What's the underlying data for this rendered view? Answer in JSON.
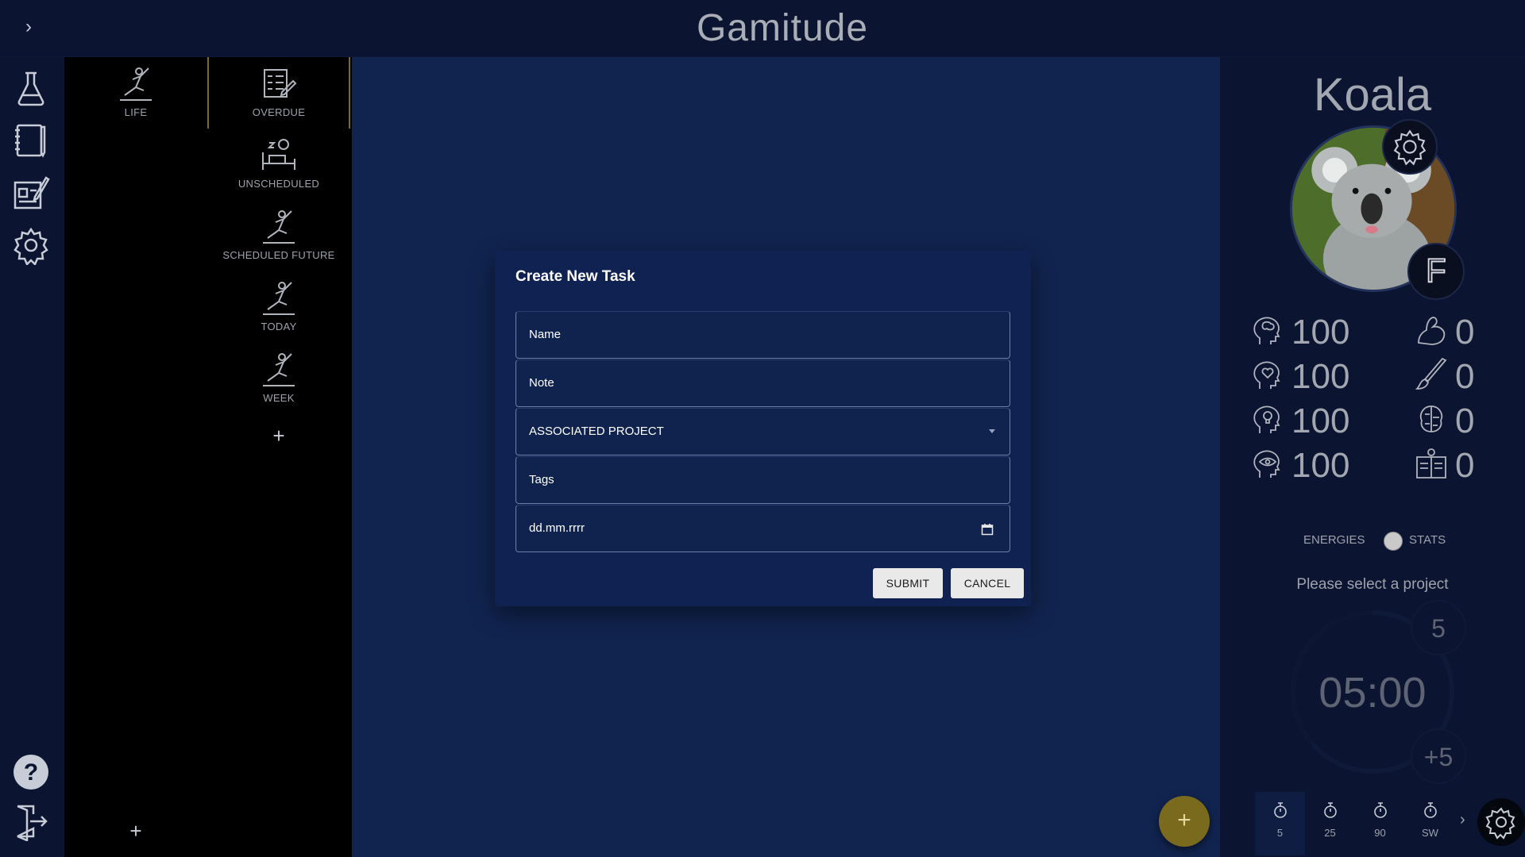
{
  "app": {
    "title": "Gamitude"
  },
  "rail": {
    "icons": [
      "flask-icon",
      "notebook-icon",
      "task-sheet-icon",
      "gear-icon",
      "help-icon",
      "logout-icon"
    ]
  },
  "projects": {
    "left": [
      {
        "label": "LIFE",
        "icon": "climber-icon"
      }
    ],
    "right": [
      {
        "label": "OVERDUE",
        "icon": "checklist-icon"
      },
      {
        "label": "UNSCHEDULED",
        "icon": "sleeping-icon"
      },
      {
        "label": "SCHEDULED FUTURE",
        "icon": "climber-icon"
      },
      {
        "label": "TODAY",
        "icon": "climber-icon"
      },
      {
        "label": "WEEK",
        "icon": "climber-icon"
      }
    ],
    "add_symbol": "+"
  },
  "dialog": {
    "title": "Create New Task",
    "fields": {
      "name": "Name",
      "note": "Note",
      "project": "ASSOCIATED PROJECT",
      "tags": "Tags",
      "date": "dd.mm.rrrr"
    },
    "submit_label": "SUBMIT",
    "cancel_label": "CANCEL"
  },
  "fab": {
    "label": "+"
  },
  "profile": {
    "name": "Koala",
    "rank_letter": "F",
    "energies": [
      {
        "icon": "brain-head-icon",
        "value": "100"
      },
      {
        "icon": "heart-head-icon",
        "value": "100"
      },
      {
        "icon": "lightbulb-head-icon",
        "value": "100"
      },
      {
        "icon": "eye-head-icon",
        "value": "100"
      }
    ],
    "stats": [
      {
        "icon": "muscle-icon",
        "value": "0"
      },
      {
        "icon": "brush-icon",
        "value": "0"
      },
      {
        "icon": "brain-circuit-icon",
        "value": "0"
      },
      {
        "icon": "book-icon",
        "value": "0"
      }
    ],
    "toggle": {
      "left_label": "ENERGIES",
      "right_label": "STATS"
    },
    "prompt": "Please select a project",
    "timer": {
      "time": "05:00",
      "top_bubble": "5",
      "bottom_bubble": "+5"
    },
    "presets": [
      "5",
      "25",
      "90",
      "SW"
    ],
    "next_symbol": "›"
  },
  "topbar": {
    "expand_symbol": "›"
  }
}
